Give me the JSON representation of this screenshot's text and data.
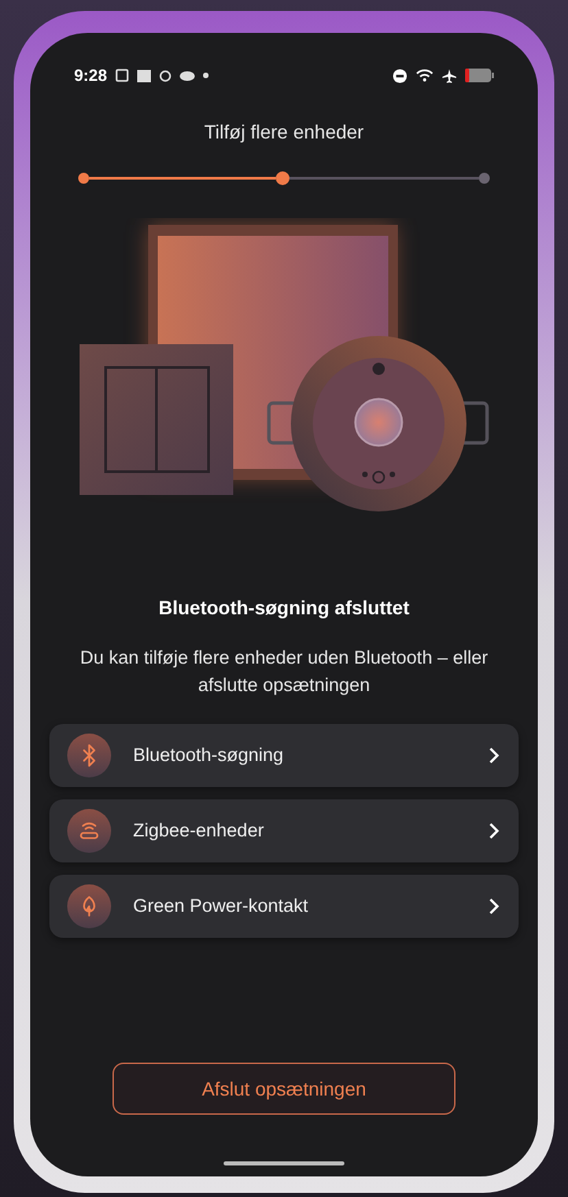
{
  "status_bar": {
    "time": "9:28"
  },
  "header": {
    "title": "Tilføj flere enheder"
  },
  "steps": [
    {
      "done": true,
      "selected": false
    },
    {
      "done": true,
      "selected": true
    },
    {
      "done": false,
      "selected": false
    }
  ],
  "heading": "Bluetooth-søgning afsluttet",
  "description": "Du kan tilføje flere enheder uden Bluetooth – eller afslutte opsætningen",
  "options": [
    {
      "kind": "bluetooth",
      "label": "Bluetooth-søgning"
    },
    {
      "kind": "zigbee",
      "label": "Zigbee-enheder"
    },
    {
      "kind": "greenpower",
      "label": "Green Power-kontakt"
    }
  ],
  "finish_button": "Afslut opsætningen"
}
